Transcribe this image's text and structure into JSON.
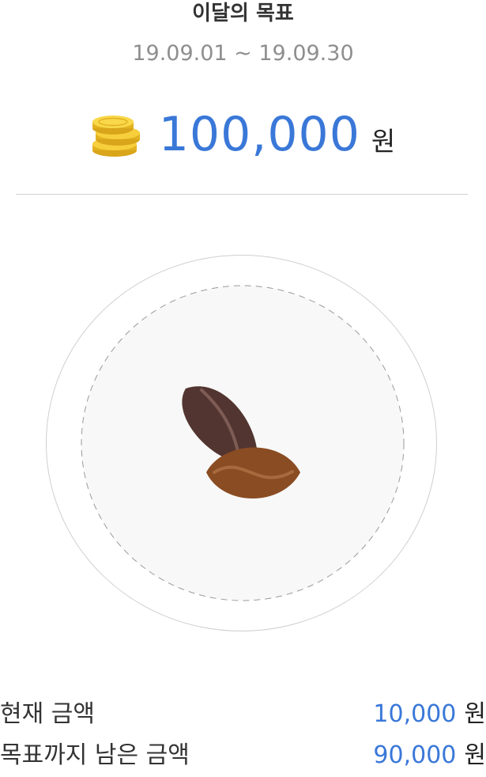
{
  "goal": {
    "title": "이달의 목표",
    "period": "19.09.01 ~ 19.09.30",
    "amount": "100,000",
    "unit": "원"
  },
  "icons": {
    "coins": "coin-stack-icon",
    "beans": "coffee-beans-icon"
  },
  "colors": {
    "accent": "#3a78d8",
    "bean_dark": "#523530",
    "bean_light": "#8a4c22"
  },
  "stats": [
    {
      "label": "현재 금액",
      "value": "10,000",
      "unit": "원"
    },
    {
      "label": "목표까지 남은 금액",
      "value": "90,000",
      "unit": "원"
    }
  ]
}
